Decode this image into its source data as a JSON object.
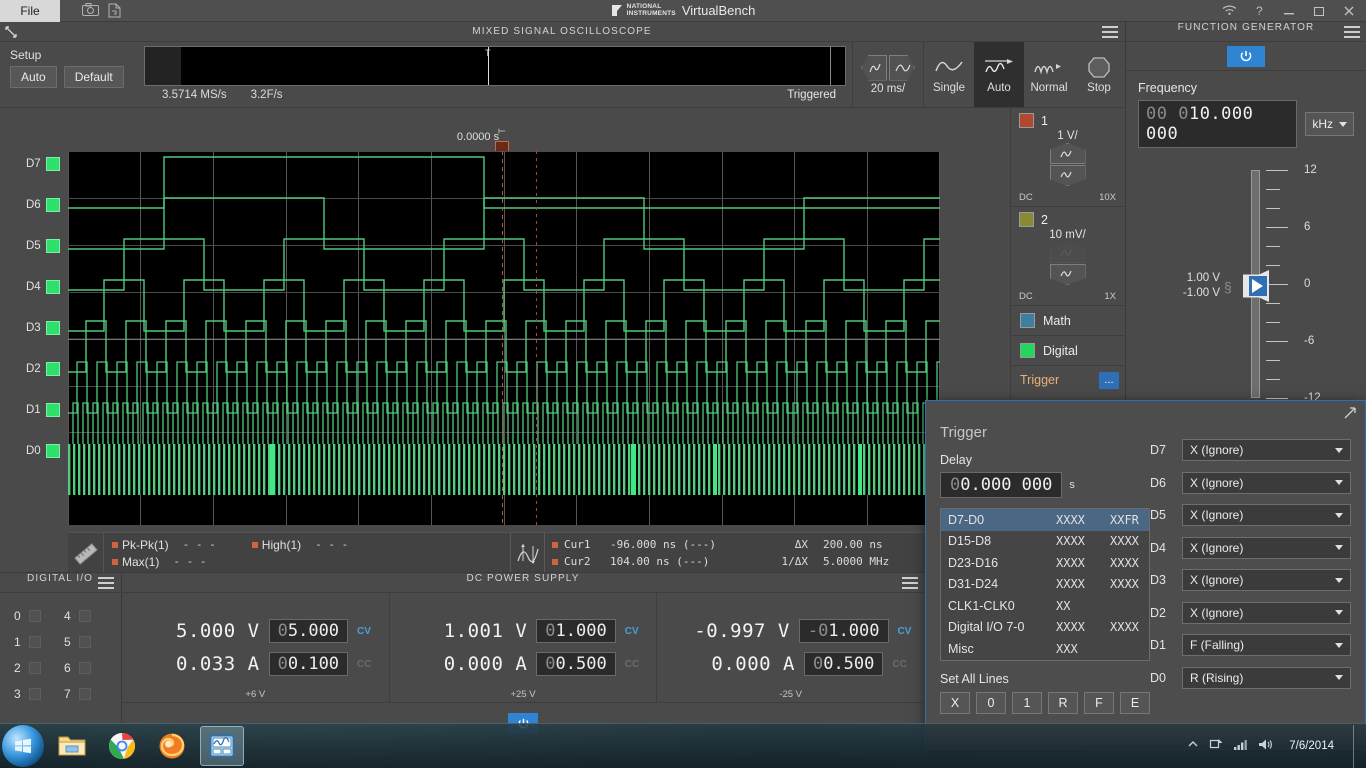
{
  "titlebar": {
    "file_menu": "File",
    "brand_line1": "NATIONAL",
    "brand_line2": "INSTRUMENTS",
    "app_title": "VirtualBench",
    "icons": [
      "camera-icon",
      "save-log-icon",
      "wifi-icon",
      "help-icon",
      "minimize-icon",
      "maximize-icon",
      "close-icon"
    ]
  },
  "scope": {
    "panel_title": "MIXED SIGNAL OSCILLOSCOPE",
    "setup": {
      "label": "Setup",
      "auto": "Auto",
      "default": "Default"
    },
    "nav": {
      "sample_rate": "3.5714 MS/s",
      "frame_rate": "3.2F/s",
      "trigger_state": "Triggered",
      "t_marker": "T"
    },
    "timebase": "20 ms/",
    "acquisition": {
      "single": "Single",
      "auto": "Auto",
      "normal": "Normal",
      "stop": "Stop",
      "selected": "Auto"
    },
    "trigger_position": {
      "time": "0.0000 s",
      "marker": "T"
    },
    "digital_labels": [
      "D7",
      "D6",
      "D5",
      "D4",
      "D3",
      "D2",
      "D1",
      "D0"
    ],
    "digital_color": "#2de06a",
    "channels": [
      {
        "number": "1",
        "scale": "1 V/",
        "coupling": "DC",
        "probe": "10X",
        "color": "#b04a2e"
      },
      {
        "number": "2",
        "scale": "10 mV/",
        "coupling": "DC",
        "probe": "1X",
        "color": "#8a8a34"
      }
    ],
    "math_label": "Math",
    "math_color": "#3e7fa0",
    "digital_label": "Digital",
    "trigger_label": "Trigger",
    "trigger_more": "...",
    "measurements": [
      {
        "name": "Pk-Pk(1)",
        "value": "- - -"
      },
      {
        "name": "High(1)",
        "value": "- - -"
      },
      {
        "name": "Max(1)",
        "value": "- - -"
      }
    ],
    "cursors": {
      "cur1_label": "Cur1",
      "cur1_value": "-96.000 ns (---)",
      "cur2_label": "Cur2",
      "cur2_value": "104.00 ns (---)",
      "dx_label": "ΔX",
      "dx_value": "200.00 ns",
      "invdx_label": "1/ΔX",
      "invdx_value": "5.0000 MHz"
    }
  },
  "function_generator": {
    "panel_title": "FUNCTION GENERATOR",
    "frequency_label": "Frequency",
    "frequency_leading": "00 0",
    "frequency_value": "10.000 000",
    "frequency_unit": "kHz",
    "amplitude_high": "1.00 V",
    "amplitude_low": "-1.00 V",
    "scale_ticks": [
      "12",
      "6",
      "0",
      "-6",
      "-12"
    ],
    "power_icon": "power-icon"
  },
  "digital_io": {
    "panel_title": "DIGITAL I/O",
    "lines_left": [
      "0",
      "1",
      "2",
      "3"
    ],
    "lines_right": [
      "4",
      "5",
      "6",
      "7"
    ]
  },
  "dc_power_supply": {
    "panel_title": "DC POWER SUPPLY",
    "rails": [
      {
        "voltage_meas": "5.000 V",
        "voltage_set_dim": "0",
        "voltage_set": "5.000",
        "voltage_mode": "CV",
        "current_meas": "0.033 A",
        "current_set_dim": "0",
        "current_set": "0.100",
        "current_mode": "CC",
        "name": "+6 V"
      },
      {
        "voltage_meas": "1.001 V",
        "voltage_set_dim": "0",
        "voltage_set": "1.000",
        "voltage_mode": "CV",
        "current_meas": "0.000 A",
        "current_set_dim": "0",
        "current_set": "0.500",
        "current_mode": "CC",
        "name": "+25 V"
      },
      {
        "voltage_meas": "-0.997 V",
        "voltage_set_dim": "-0",
        "voltage_set": "1.000",
        "voltage_mode": "CV",
        "current_meas": "0.000 A",
        "current_set_dim": "0",
        "current_set": "0.500",
        "current_mode": "CC",
        "name": "-25 V"
      }
    ],
    "power_icon": "power-icon"
  },
  "trigger_dialog": {
    "title": "Trigger",
    "delay_label": "Delay",
    "delay_leading": "0",
    "delay_value": "0.000 000",
    "delay_unit": "s",
    "rows": [
      {
        "name": "D7-D0",
        "a": "XXXX",
        "b": "XXFR",
        "selected": true
      },
      {
        "name": "D15-D8",
        "a": "XXXX",
        "b": "XXXX",
        "selected": false
      },
      {
        "name": "D23-D16",
        "a": "XXXX",
        "b": "XXXX",
        "selected": false
      },
      {
        "name": "D31-D24",
        "a": "XXXX",
        "b": "XXXX",
        "selected": false
      },
      {
        "name": "CLK1-CLK0",
        "a": "XX",
        "b": "",
        "selected": false
      },
      {
        "name": "Digital I/O 7-0",
        "a": "XXXX",
        "b": "XXXX",
        "selected": false
      },
      {
        "name": "Misc",
        "a": "XXX",
        "b": "",
        "selected": false
      }
    ],
    "set_all_label": "Set All Lines",
    "set_all_buttons": [
      "X",
      "0",
      "1",
      "R",
      "F",
      "E"
    ],
    "lines": [
      {
        "label": "D7",
        "value": "X (Ignore)"
      },
      {
        "label": "D6",
        "value": "X (Ignore)"
      },
      {
        "label": "D5",
        "value": "X (Ignore)"
      },
      {
        "label": "D4",
        "value": "X (Ignore)"
      },
      {
        "label": "D3",
        "value": "X (Ignore)"
      },
      {
        "label": "D2",
        "value": "X (Ignore)"
      },
      {
        "label": "D1",
        "value": "F (Falling)"
      },
      {
        "label": "D0",
        "value": "R (Rising)"
      }
    ],
    "accent_color": "#2f6fb5"
  },
  "taskbar": {
    "start": "start-orb-icon",
    "items": [
      "file-explorer-icon",
      "chrome-icon",
      "firefox-icon",
      "virtualbench-icon"
    ],
    "tray_icons": [
      "show-hidden-icon",
      "action-center-icon",
      "network-icon",
      "volume-icon"
    ],
    "clock": "7/6/2014"
  }
}
